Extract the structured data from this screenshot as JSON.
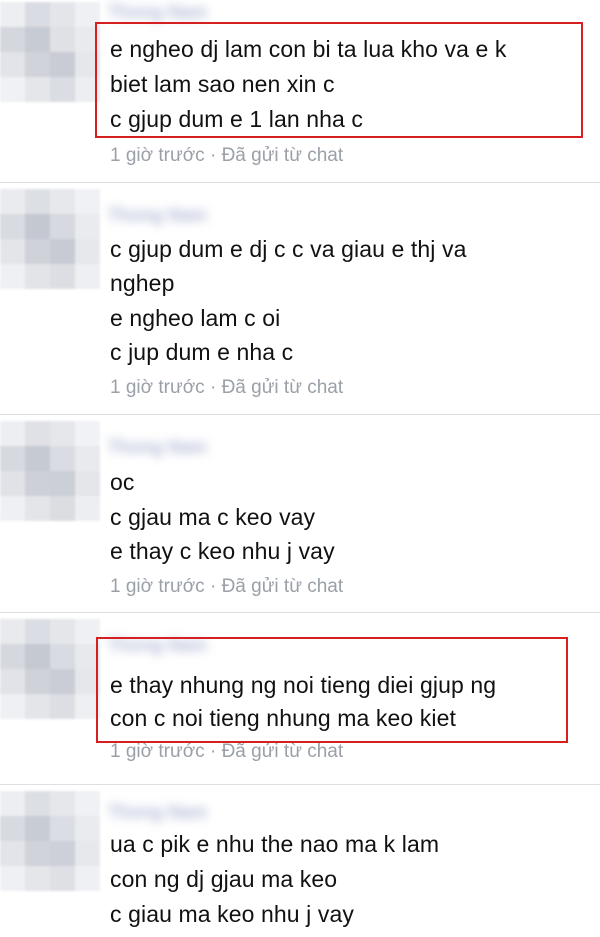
{
  "messages": [
    {
      "sender": "Thong Nam",
      "lines": [
        "e ngheo dj lam con bi ta lua kho va e k",
        "biet lam sao nen xin c",
        "c gjup dum e 1 lan nha c"
      ],
      "time": "1 giờ trước",
      "separator": " · ",
      "via": "Đã gửi từ chat",
      "highlighted": true
    },
    {
      "sender": "Thong Nam",
      "lines": [
        "c gjup dum e dj c c va giau e thj va",
        "nghep",
        "e ngheo lam c oi",
        "c jup dum e nha c"
      ],
      "time": "1 giờ trước",
      "separator": " · ",
      "via": "Đã gửi từ chat",
      "highlighted": false
    },
    {
      "sender": "Thong Nam",
      "lines": [
        "oc",
        "c gjau ma c keo vay",
        "e thay c keo nhu j vay"
      ],
      "time": "1 giờ trước",
      "separator": " · ",
      "via": "Đã gửi từ chat",
      "highlighted": false
    },
    {
      "sender": "Thong Nam",
      "lines": [
        "e thay nhung ng noi tieng diei gjup ng",
        "con c noi tieng nhung ma keo kiet"
      ],
      "time": "1 giờ trước",
      "separator": " · ",
      "via": "Đã gửi từ chat",
      "highlighted": true
    },
    {
      "sender": "Thong Nam",
      "lines": [
        "ua c pik e nhu the nao ma k lam",
        "con ng dj gjau ma keo",
        "c giau ma keo nhu j vay"
      ],
      "highlighted": false
    }
  ],
  "colors": {
    "highlight_border": "#d62020",
    "text": "#111111",
    "meta": "#9aa0a8",
    "avatar_palette": [
      "#e7e8ec",
      "#d2d5dc",
      "#c3c7d0",
      "#eef0f3",
      "#dadce2"
    ]
  }
}
